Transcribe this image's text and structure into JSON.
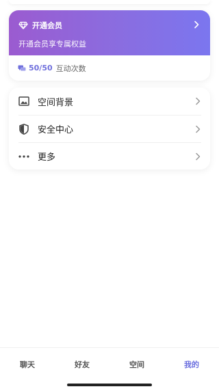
{
  "vip": {
    "title": "开通会员",
    "subtitle": "开通会员享专属权益",
    "count": "50/50",
    "count_label": "互动次数"
  },
  "menu": {
    "items": [
      {
        "label": "空间背景",
        "icon": "image-icon"
      },
      {
        "label": "安全中心",
        "icon": "shield-icon"
      },
      {
        "label": "更多",
        "icon": "more-dots-icon"
      }
    ]
  },
  "tabs": [
    {
      "label": "聊天"
    },
    {
      "label": "好友"
    },
    {
      "label": "空间"
    },
    {
      "label": "我的",
      "active": true
    }
  ],
  "colors": {
    "accent": "#6b6fdf",
    "banner_start": "#9b5bd0",
    "banner_end": "#7b76ef"
  }
}
